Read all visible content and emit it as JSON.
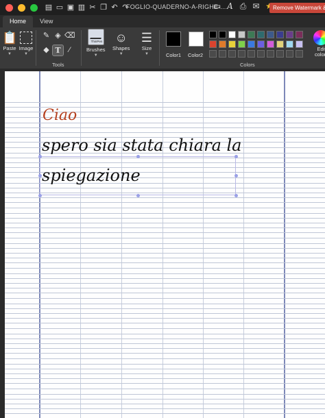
{
  "window": {
    "title": "FOGLIO-QUADERNO-A-RIGHE-...",
    "watermark_button": "Remove Watermark & A"
  },
  "tabs": [
    {
      "label": "Home",
      "active": true
    },
    {
      "label": "View",
      "active": false
    }
  ],
  "ribbon": {
    "clipboard": {
      "paste_label": "Paste",
      "image_label": "Image"
    },
    "tools": {
      "group_label": "Tools"
    },
    "brushes": {
      "label": "Brushes",
      "thumbnail_label": "ThinPen"
    },
    "shapes": {
      "label": "Shapes"
    },
    "size": {
      "label": "Size"
    },
    "colors": {
      "group_label": "Colors",
      "color1_label": "Color1",
      "color2_label": "Color2",
      "color1_value": "#000000",
      "color2_value": "#ffffff",
      "edit_label": "Edit colors",
      "palette_row1": [
        "#000000",
        "#000000",
        "#ffffff",
        "#c8c8c8",
        "#3d7a55",
        "#2e6b6e",
        "#3d5a8a",
        "#3a3d8e",
        "#6a3d8a",
        "#7a2e5a"
      ],
      "palette_row2": [
        "#d9432e",
        "#e07b2b",
        "#e8d23a",
        "#7ed14a",
        "#3a7ae0",
        "#6b5fe0",
        "#d35cd9",
        "#e0d27a",
        "#9ed8f0",
        "#c7c0f0"
      ],
      "palette_row3": [
        "",
        "",
        "",
        "",
        "",
        "",
        "",
        "",
        "",
        ""
      ]
    }
  },
  "canvas": {
    "text_red": "Ciao",
    "text_line1": "spero sia stata chiara la",
    "text_line2": "spiegazione",
    "ink_color": "#111111",
    "accent_color": "#b5401f"
  }
}
